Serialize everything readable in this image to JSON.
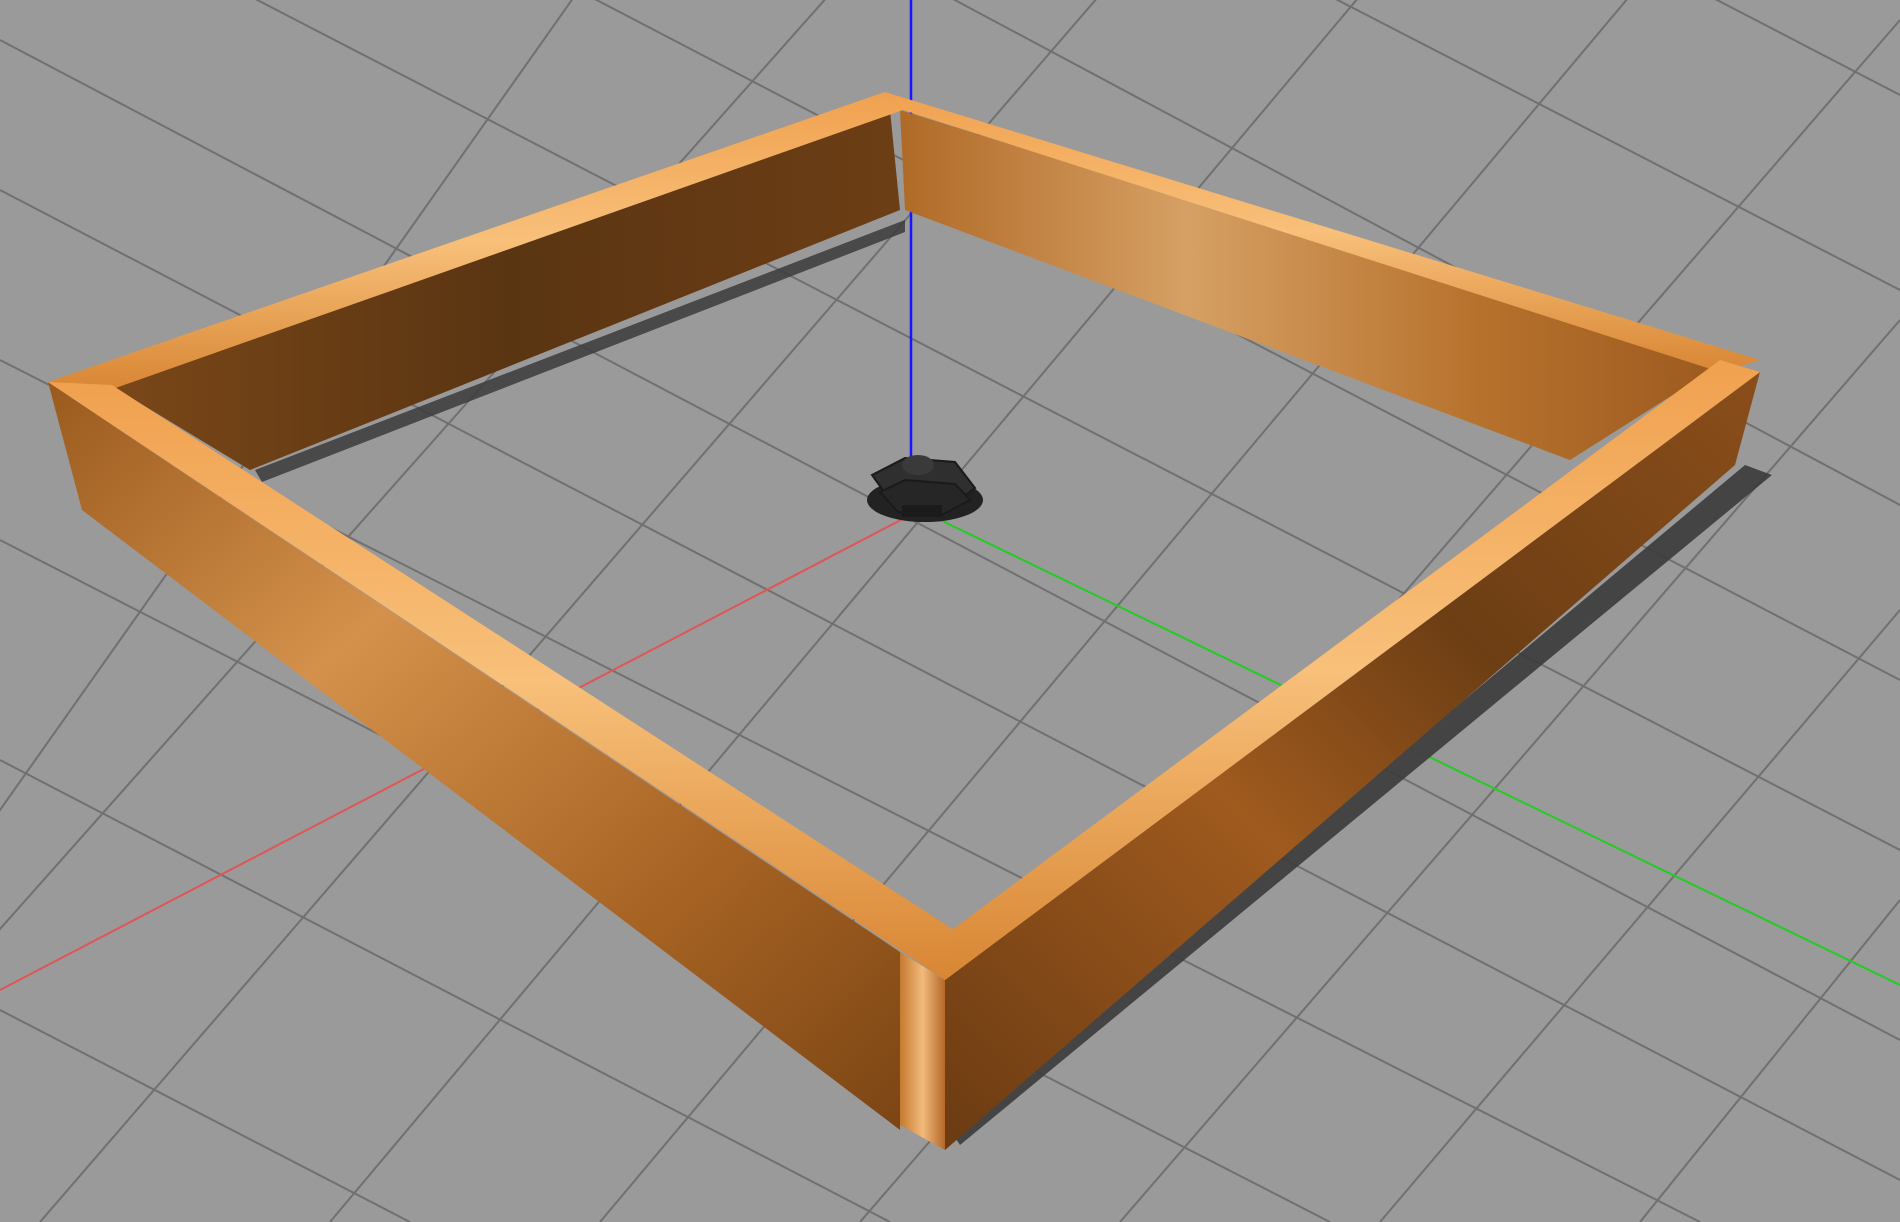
{
  "viewport": {
    "ground_color": "#9a9a9a",
    "grid_line_color": "#6f6f6f",
    "axis_colors": {
      "x": "#e05555",
      "y": "#22cc22",
      "z": "#1515ff"
    }
  },
  "scene": {
    "objects": [
      {
        "name": "wooden-wall-enclosure",
        "color": "#c5782c"
      },
      {
        "name": "mobile-robot",
        "color": "#2a2a2a"
      }
    ]
  }
}
